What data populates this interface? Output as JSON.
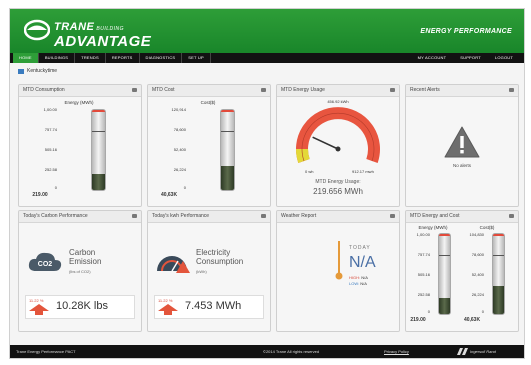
{
  "header": {
    "logo_brand": "TRANE",
    "logo_sub": "BUILDING",
    "logo_adv": "ADVANTAGE",
    "right_title": "ENERGY PERFORMANCE",
    "accent_color": "#2e9e38"
  },
  "nav": {
    "left": [
      "HOME",
      "BUILDINGS",
      "TRENDS",
      "REPORTS",
      "DIAGNOSTICS",
      "SET UP"
    ],
    "active_index": 0,
    "right": [
      "MY ACCOUNT",
      "SUPPORT",
      "LOGOUT"
    ]
  },
  "breadcrumb": {
    "icon": "building-icon",
    "text": "Kentuckytime"
  },
  "cards": {
    "mtd_consumption": {
      "title": "MTD Consumption",
      "meter_title": "Energy (MWh)",
      "scale": [
        "1,00.00",
        "757.74",
        "505.16",
        "252.58",
        "0"
      ],
      "value": "219.00",
      "fill_fraction": 0.2,
      "marker_fraction": 0.72
    },
    "mtd_cost": {
      "title": "MTD Cost",
      "meter_title": "Cost($)",
      "scale": [
        "120,914",
        "78,600",
        "52,400",
        "26,224",
        "0"
      ],
      "value": "40,63K",
      "fill_fraction": 0.3,
      "marker_fraction": 0.72
    },
    "mtd_energy_usage": {
      "title": "MTD Energy Usage",
      "gauge_top": "456.92 kWh",
      "gauge_min": "0 wh",
      "gauge_max": "912.17 mwh",
      "caption": "MTD Energy Usage:",
      "value": "219.656 MWh",
      "needle_fraction": 0.24
    },
    "recent_alerts": {
      "title": "Recent Alerts",
      "status": "No alerts"
    },
    "carbon": {
      "title": "Today's Carbon Performance",
      "label_line1": "Carbon",
      "label_line2": "Emission",
      "unit": "(lbs of CO2)",
      "icon_text": "CO2",
      "pct": "11.22 %",
      "value": "10.28K lbs"
    },
    "kwh": {
      "title": "Today's kwh Performance",
      "label_line1": "Electricity",
      "label_line2": "Consumption",
      "unit": "(kWh)",
      "pct": "11.22 %",
      "value": "7.453 MWh"
    },
    "weather": {
      "title": "Weather Report",
      "today": "TODAY",
      "na": "N/A",
      "high_label": "HIGH:",
      "high_value": "N/A",
      "low_label": "LOW:",
      "low_value": "N/A"
    },
    "mtd_energy_cost": {
      "title": "MTD Energy and Cost",
      "energy": {
        "meter_title": "Energy (MWh)",
        "scale": [
          "1,00.00",
          "757.74",
          "505.16",
          "252.58",
          "0"
        ],
        "value": "219.00",
        "fill_fraction": 0.2,
        "marker_fraction": 0.72
      },
      "cost": {
        "meter_title": "Cost($)",
        "scale": [
          "104,830",
          "78,600",
          "52,400",
          "26,224",
          "0"
        ],
        "value": "40,63K",
        "fill_fraction": 0.35,
        "marker_fraction": 0.72
      }
    }
  },
  "footer": {
    "left": "Trane Energy Performance PACT",
    "center": "©2014 Trane All rights reserved",
    "link": "Privacy Policy",
    "brand": "Ingersoll Rand"
  }
}
